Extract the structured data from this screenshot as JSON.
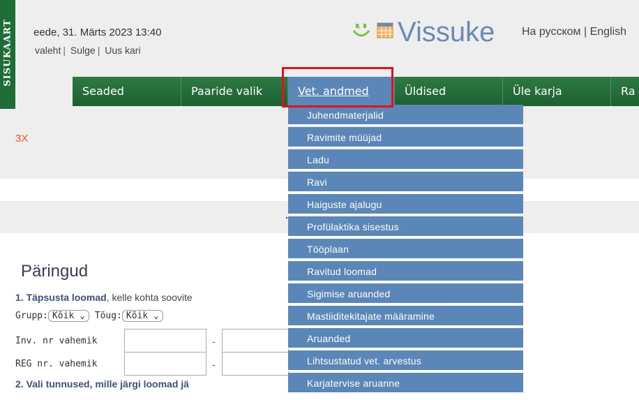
{
  "sidebar": {
    "label": "SISUKAART"
  },
  "header": {
    "datetime": "eede, 31. Märts 2023 13:40",
    "links": [
      "valeht",
      "Sulge",
      "Uus kari"
    ],
    "brand": "Vissuke",
    "lang_links": "На русском | English"
  },
  "nav": {
    "items": [
      {
        "label": "Seaded"
      },
      {
        "label": "Paaride valik"
      },
      {
        "label": "Vet. andmed",
        "active": true
      },
      {
        "label": "Üldised"
      },
      {
        "label": "Üle karja"
      },
      {
        "label": "Ra"
      }
    ]
  },
  "dropdown": {
    "items": [
      "Juhendmaterjalid",
      "Ravimite müüjad",
      "Ladu",
      "Ravi",
      "Haiguste ajalugu",
      "Profülaktika sisestus",
      "Tööplaan",
      "Ravitud loomad",
      "Sigimise aruanded",
      "Mastiiditekitajate määramine",
      "Aruanded",
      "Lihtsustatud vet. arvestus",
      "Karjatervise  aruanne"
    ]
  },
  "main": {
    "count": "3X",
    "queries_title": "Päringud",
    "step1_bold": "1. Täpsusta loomad",
    "step1_rest": ", kelle kohta soovite",
    "group_label": "Grupp:",
    "group_value": "Kõik",
    "breed_label": "Tõug:",
    "breed_value": "Kõik",
    "inv_label": "Inv. nr vahemik",
    "reg_label": "REG nr. vahemik",
    "dash": "-",
    "step2": "2. Vali tunnused, mille järgi loomad jä"
  },
  "colors": {
    "nav_green": "#2e7a45",
    "menu_blue": "#5a86b8",
    "highlight_red": "#e1121b",
    "brand_blue": "#6b8bb5"
  }
}
